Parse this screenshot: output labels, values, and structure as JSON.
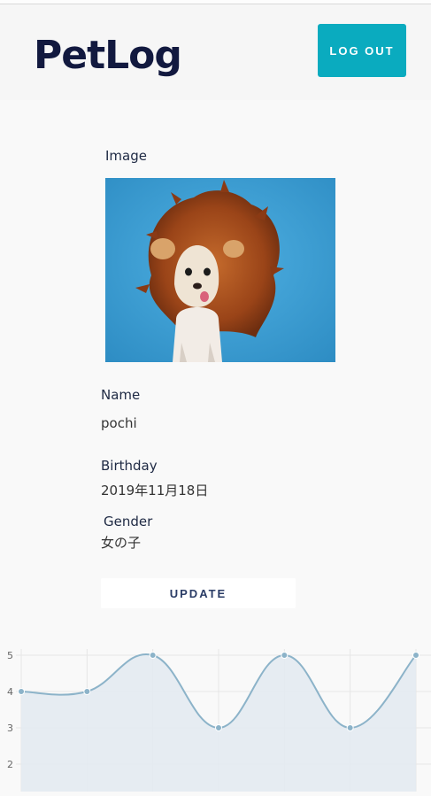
{
  "app": {
    "title": "PetLog"
  },
  "header": {
    "logout_label": "LOG OUT"
  },
  "pet": {
    "image_label": "Image",
    "name_label": "Name",
    "name_value": "pochi",
    "birthday_label": "Birthday",
    "birthday_value": "2019年11月18日",
    "gender_label": "Gender",
    "gender_value": "女の子"
  },
  "actions": {
    "update_label": "UPDATE"
  },
  "colors": {
    "brand_dark": "#12193f",
    "accent": "#0aabbf",
    "chart_line": "#8cb3c9",
    "chart_fill": "#e3eaf1"
  },
  "chart_data": {
    "type": "line",
    "x": [
      1,
      2,
      3,
      4,
      5,
      6,
      7
    ],
    "series": [
      {
        "values": [
          4,
          4,
          5,
          3,
          5,
          3,
          5
        ]
      }
    ],
    "yticks": [
      "5",
      "4",
      "3",
      "2"
    ],
    "ylim": [
      1.2,
      5.2
    ],
    "fill": true,
    "smooth": true,
    "grid": true,
    "legend": "none"
  }
}
